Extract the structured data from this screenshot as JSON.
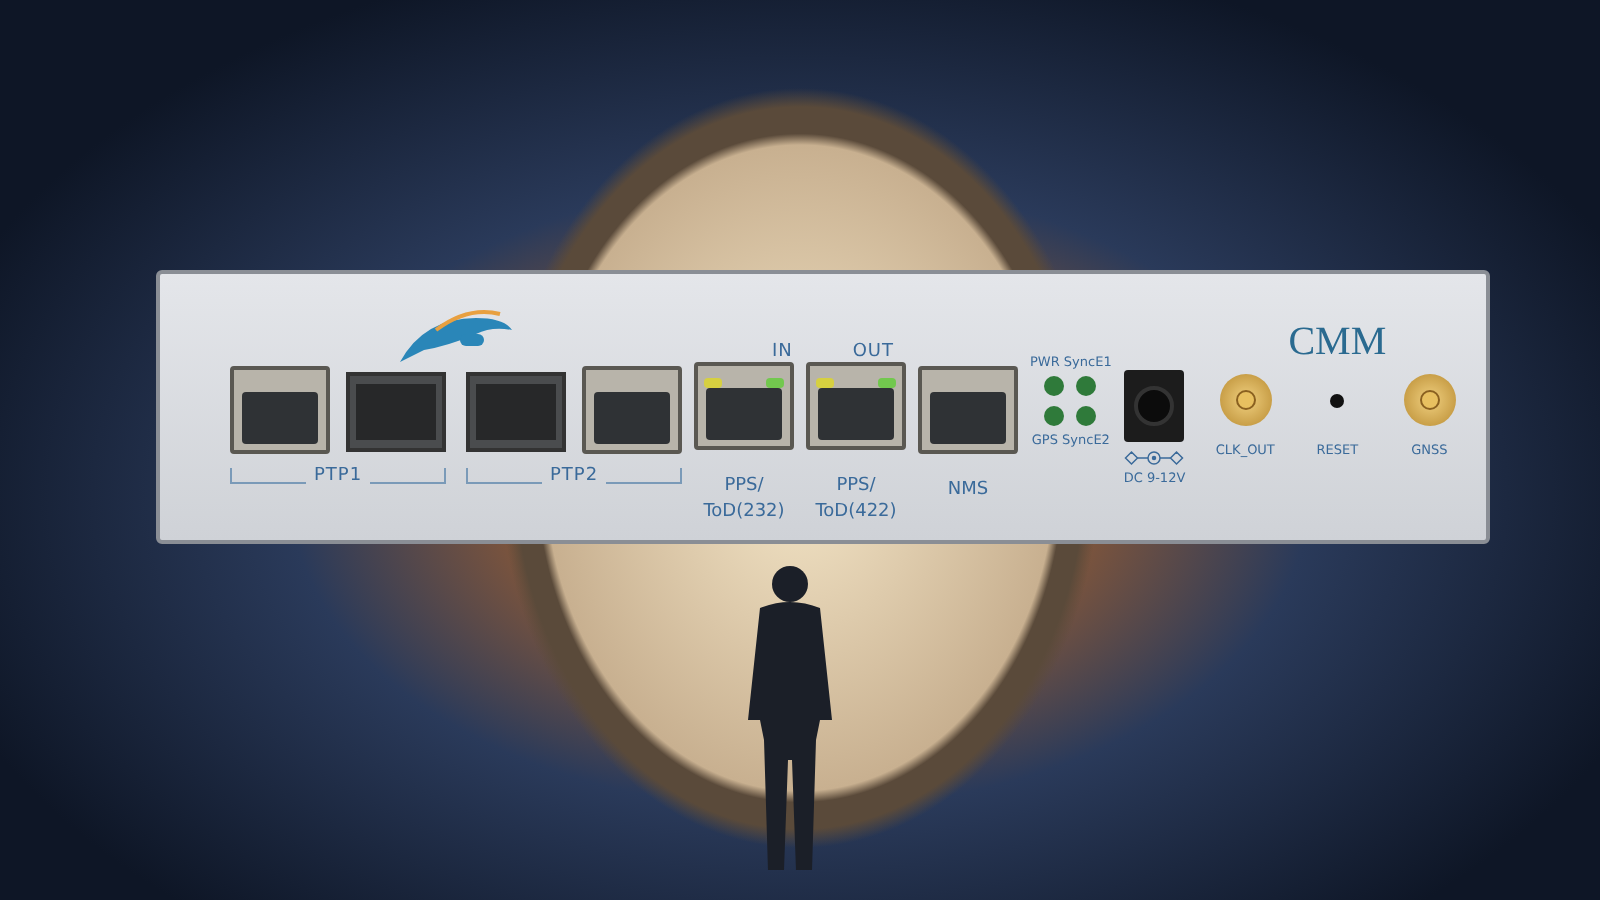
{
  "device": {
    "model": "CMM",
    "ptp_groups": [
      {
        "label": "PTP1",
        "ports": [
          {
            "kind": "rj45"
          },
          {
            "kind": "sfp"
          }
        ]
      },
      {
        "label": "PTP2",
        "ports": [
          {
            "kind": "sfp"
          },
          {
            "kind": "rj45"
          }
        ]
      }
    ],
    "pps_ports": [
      {
        "caption_lines": [
          "PPS/",
          "ToD(232)"
        ],
        "leds": [
          {
            "color": "#d6d040"
          },
          {
            "color": "#72c84e"
          }
        ]
      },
      {
        "caption_lines": [
          "PPS/",
          "ToD(422)"
        ],
        "leds": [
          {
            "color": "#d6d040"
          },
          {
            "color": "#72c84e"
          }
        ]
      }
    ],
    "pps_indicators": [
      "IN",
      "OUT"
    ],
    "nms_port": {
      "label": "NMS"
    },
    "status_leds": {
      "top_label": "PWR SyncE1",
      "bottom_label": "GPS SyncE2"
    },
    "dc_input": {
      "label": "DC 9-12V"
    },
    "connectors": [
      {
        "kind": "sma",
        "label": "CLK_OUT"
      },
      {
        "kind": "reset",
        "label": "RESET"
      },
      {
        "kind": "sma",
        "label": "GNSS"
      }
    ]
  }
}
